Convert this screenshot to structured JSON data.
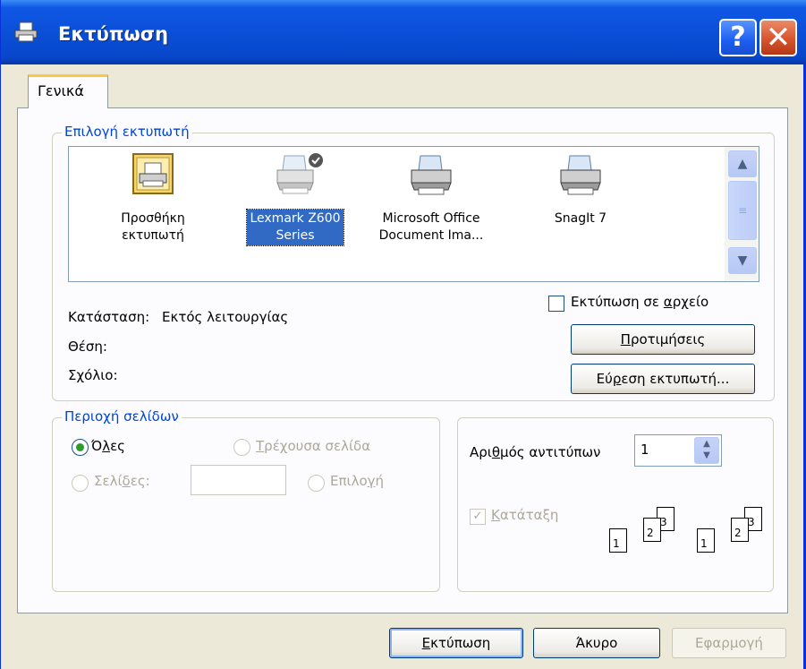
{
  "window": {
    "title": "Εκτύπωση",
    "help_label": "?",
    "close_label": "✕"
  },
  "tabs": [
    {
      "label": "Γενικά"
    }
  ],
  "printer_selection": {
    "legend": "Επιλογή εκτυπωτή",
    "printers": [
      {
        "label_line1": "Προσθήκη",
        "label_line2": "εκτυπωτή",
        "icon": "add-printer-icon",
        "selected": false
      },
      {
        "label_line1": "Lexmark Z600",
        "label_line2": "Series",
        "icon": "printer-default-icon",
        "selected": true
      },
      {
        "label_line1": "Microsoft Office",
        "label_line2": "Document Ima...",
        "icon": "printer-icon",
        "selected": false
      },
      {
        "label_line1": "SnagIt 7",
        "label_line2": "",
        "icon": "printer-icon",
        "selected": false
      }
    ],
    "status_label": "Κατάσταση:",
    "status_value": "Εκτός λειτουργίας",
    "location_label": "Θέση:",
    "comment_label": "Σχόλιο:",
    "print_to_file_pre": "Εκτύπωση σε ",
    "print_to_file_accel": "α",
    "print_to_file_post": "ρχείο",
    "preferences_accel": "Π",
    "preferences_rest": "ροτιμήσεις",
    "find_printer_pre": "Εύ",
    "find_printer_accel": "ρ",
    "find_printer_post": "εση εκτυπωτή..."
  },
  "page_range": {
    "legend": "Περιοχή σελίδων",
    "all_pre": "Ό",
    "all_accel": "λ",
    "all_post": "ες",
    "current_accel": "Τ",
    "current_rest": "ρέχουσα σελίδα",
    "pages_pre": "Σελί",
    "pages_accel": "δ",
    "pages_post": "ες:",
    "pages_value": "",
    "selection_pre": "Επιλο",
    "selection_accel": "γ",
    "selection_post": "ή"
  },
  "copies": {
    "label_pre": "Αρι",
    "label_accel": "θ",
    "label_post": "μός αντιτύπων",
    "value": "1",
    "collate_accel": "Κ",
    "collate_rest": "ατάταξη",
    "collate_checked": true,
    "collate_pages_1": [
      "1",
      "2",
      "3"
    ],
    "collate_pages_2": [
      "1",
      "2",
      "3"
    ]
  },
  "footer": {
    "print_accel": "Ε",
    "print_rest": "κτύπωση",
    "cancel": "Άκυρο",
    "apply": "Εφαρμογή"
  },
  "colors": {
    "title_bar": "#0a4ed5",
    "accent_blue": "#0046d5",
    "selection": "#316ac5",
    "dialog_bg": "#ece9d8"
  }
}
